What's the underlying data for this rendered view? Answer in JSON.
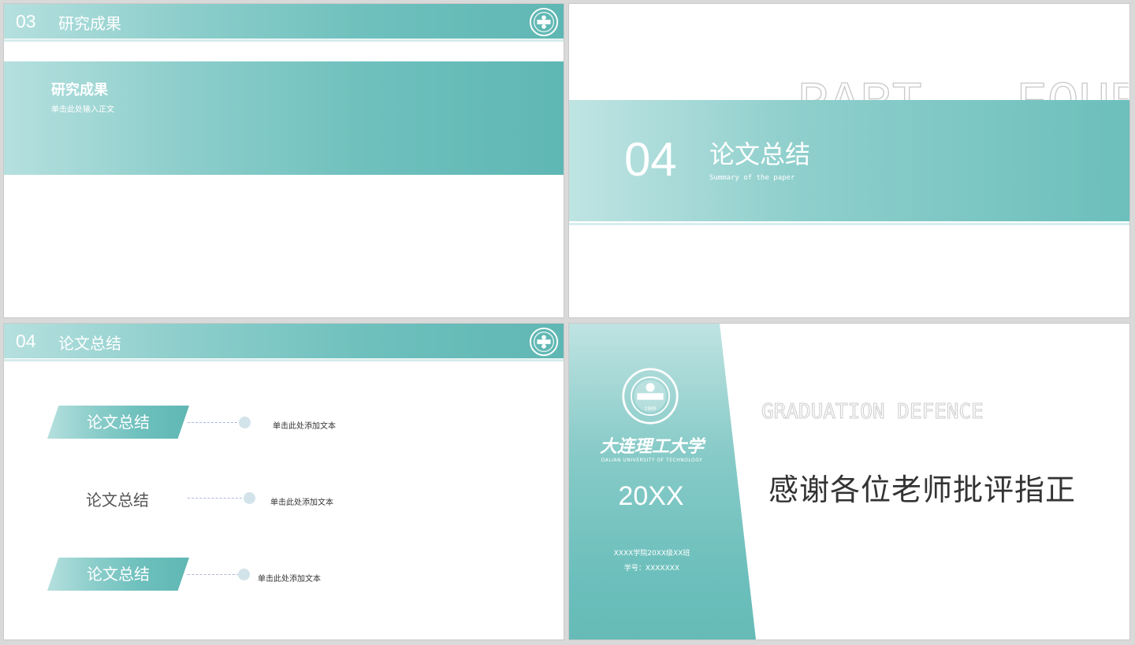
{
  "slide1": {
    "header_num": "03",
    "header_title": "研究成果",
    "band_title": "研究成果",
    "band_sub": "单击此处输入正文"
  },
  "slide2": {
    "part_text": "PART   FOUR",
    "num": "04",
    "title": "论文总结",
    "subtitle": "Summary of the paper"
  },
  "slide3": {
    "header_num": "04",
    "header_title": "论文总结",
    "items": [
      {
        "label": "论文总结",
        "note": "单击此处添加文本"
      },
      {
        "label": "论文总结",
        "note": "单击此处添加文本"
      },
      {
        "label": "论文总结",
        "note": "单击此处添加文本"
      }
    ]
  },
  "slide4": {
    "school_cn": "大连理工大学",
    "school_en": "DALIAN UNIVERSITY OF TECHNOLOGY",
    "logo_year": "1949",
    "year": "20XX",
    "class_line": "XXXX学院20XX级XX班",
    "id_line": "学号：XXXXXXX",
    "grad_text": "GRADUATION DEFENCE",
    "thanks": "感谢各位老师批评指正"
  },
  "colors": {
    "teal_light": "#b5e0df",
    "teal_dark": "#5fb7b3",
    "dot": "#d2e3ea",
    "dash": "#aeb6de"
  }
}
